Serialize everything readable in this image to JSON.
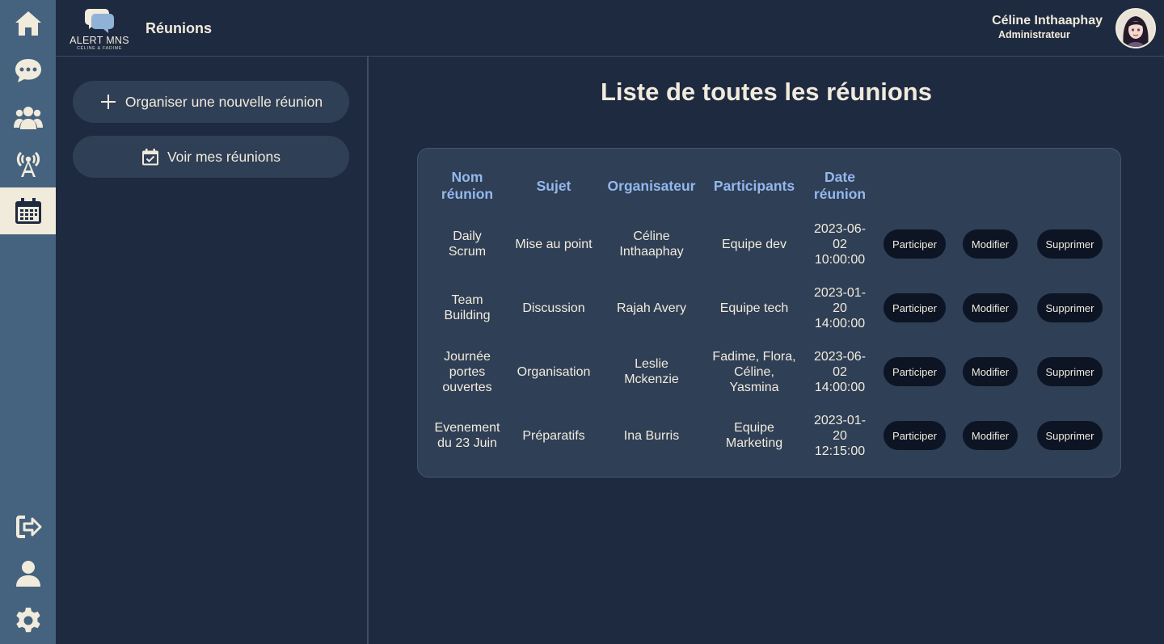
{
  "header": {
    "page_title": "Réunions",
    "logo_text": "ALERT MNS",
    "logo_subtext": "CÉLINE & FADIME",
    "user_name": "Céline Inthaaphay",
    "user_role": "Administrateur"
  },
  "sidebar": {
    "items": [
      {
        "icon": "home-icon",
        "active": false
      },
      {
        "icon": "chat-icon",
        "active": false
      },
      {
        "icon": "users-icon",
        "active": false
      },
      {
        "icon": "broadcast-icon",
        "active": false
      },
      {
        "icon": "calendar-icon",
        "active": true
      }
    ],
    "bottom_items": [
      {
        "icon": "logout-icon"
      },
      {
        "icon": "user-icon"
      },
      {
        "icon": "gear-icon"
      }
    ]
  },
  "actions": {
    "new_meeting": "Organiser une nouvelle réunion",
    "my_meetings": "Voir mes réunions"
  },
  "main": {
    "title": "Liste de toutes les réunions"
  },
  "table": {
    "headers": [
      "Nom réunion",
      "Sujet",
      "Organisateur",
      "Participants",
      "Date réunion"
    ],
    "button_labels": {
      "join": "Participer",
      "edit": "Modifier",
      "delete": "Supprimer"
    },
    "rows": [
      {
        "name": "Daily Scrum",
        "subject": "Mise au point",
        "organizer": "Céline Inthaaphay",
        "participants": "Equipe dev",
        "date": "2023-06-02 10:00:00"
      },
      {
        "name": "Team Building",
        "subject": "Discussion",
        "organizer": "Rajah Avery",
        "participants": "Equipe tech",
        "date": "2023-01-20 14:00:00"
      },
      {
        "name": "Journée portes ouvertes",
        "subject": "Organisation",
        "organizer": "Leslie Mckenzie",
        "participants": "Fadime, Flora, Céline, Yasmina",
        "date": "2023-06-02 14:00:00"
      },
      {
        "name": "Evenement du 23 Juin",
        "subject": "Préparatifs",
        "organizer": "Ina Burris",
        "participants": "Equipe Marketing",
        "date": "2023-01-20 12:15:00"
      }
    ]
  },
  "colors": {
    "background": "#1e2a40",
    "rail": "#45637f",
    "card": "#2f3f56",
    "header_text": "#93b8ec",
    "text": "#f1ebdc",
    "pill": "#0d1424"
  }
}
